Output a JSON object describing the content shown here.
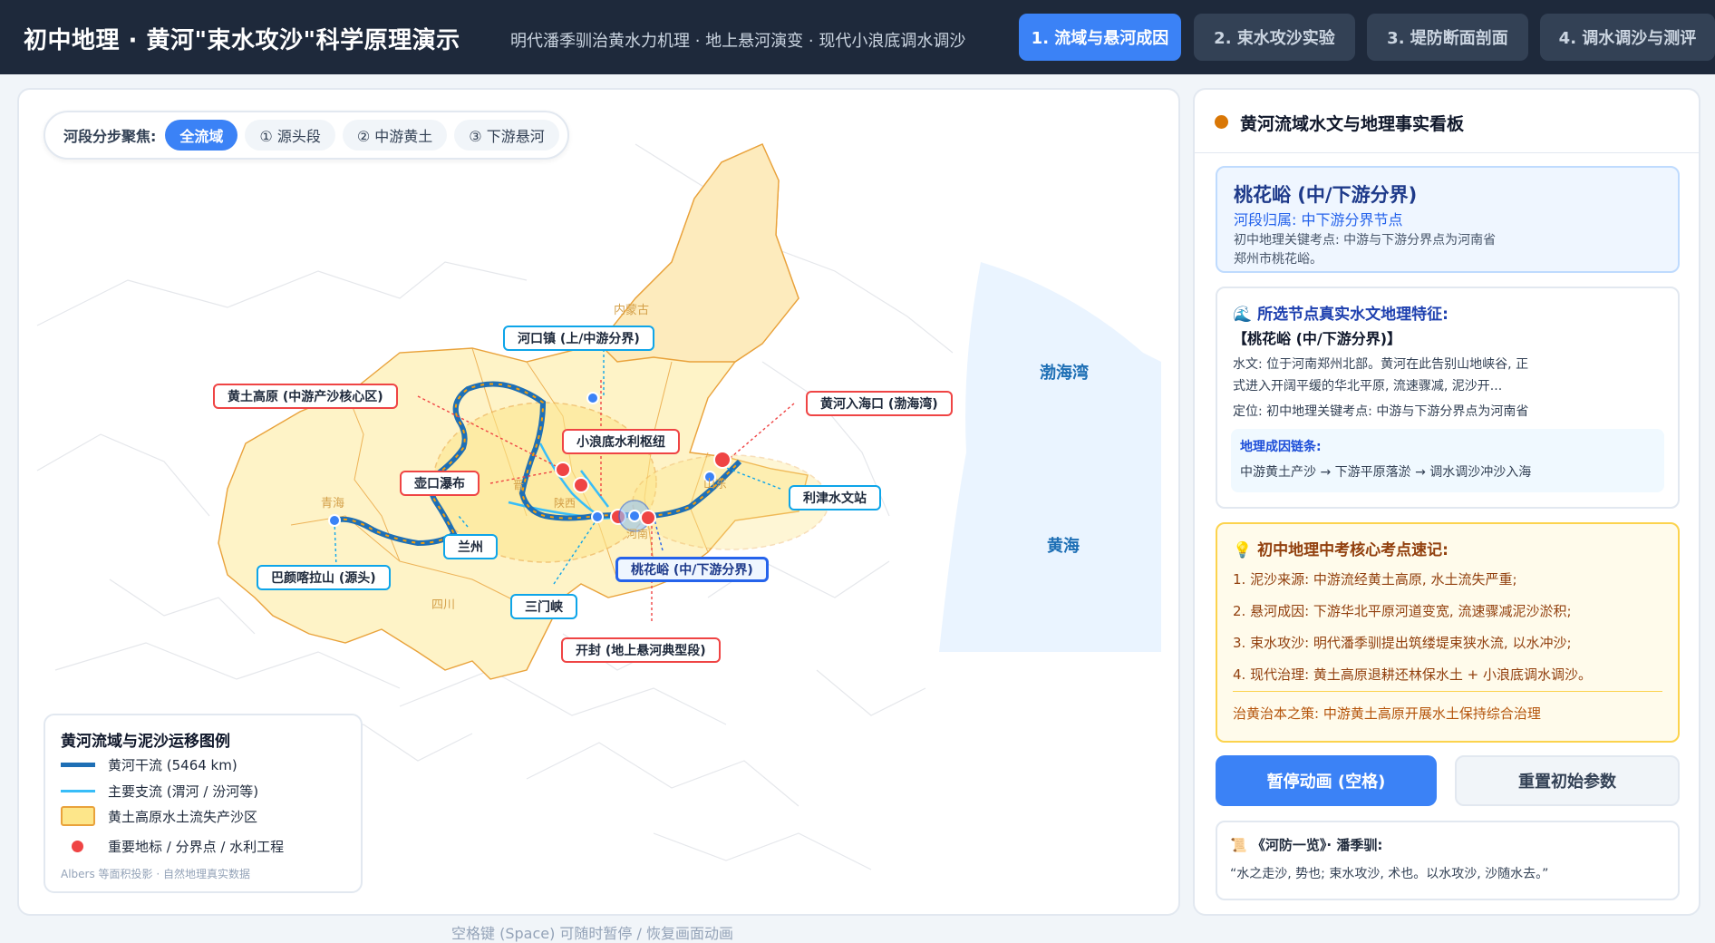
{
  "header": {
    "title": "初中地理 · 黄河\"束水攻沙\"科学原理演示",
    "subtitle": "明代潘季驯治黄水力机理 · 地上悬河演变 · 现代小浪底调水调沙",
    "tabs": [
      {
        "label": "1. 流域与悬河成因",
        "active": true
      },
      {
        "label": "2. 束水攻沙实验",
        "active": false
      },
      {
        "label": "3. 堤防断面剖面",
        "active": false
      },
      {
        "label": "4. 调水调沙与测评",
        "active": false
      }
    ]
  },
  "map": {
    "segment_label": "河段分步聚焦:",
    "segments": [
      {
        "label": "全流域",
        "active": true
      },
      {
        "label": "① 源头段",
        "active": false
      },
      {
        "label": "② 中游黄土",
        "active": false
      },
      {
        "label": "③ 下游悬河",
        "active": false
      }
    ],
    "sea_labels": [
      "渤海湾",
      "黄海"
    ],
    "region_labels": [
      "内蒙古",
      "青海",
      "四川",
      "山东",
      "陕西",
      "河南",
      "晋"
    ],
    "callouts": {
      "hekou": "河口镇 (上/中游分界)",
      "loess": "黄土高原 (中游产沙核心区)",
      "estuary": "黄河入海口 (渤海湾)",
      "xiaolangdi": "小浪底水利枢纽",
      "hukou": "壶口瀑布",
      "lijin": "利津水文站",
      "lanzhou": "兰州",
      "bayan": "巴颜喀拉山 (源头)",
      "taohuayu": "桃花峪 (中/下游分界)",
      "sanmenxia": "三门峡",
      "kaifeng": "开封 (地上悬河典型段)"
    },
    "legend": {
      "title": "黄河流域与泥沙运移图例",
      "items": [
        {
          "label": "黄河干流 (5464 km)",
          "color": "#1e6fb5"
        },
        {
          "label": "主要支流 (渭河 / 汾河等)",
          "color": "#38bdf8"
        },
        {
          "label": "黄土高原水土流失产沙区",
          "color": "#fde68a"
        },
        {
          "label": "重要地标 / 分界点 / 水利工程",
          "color": "#ef4444"
        }
      ],
      "note": "Albers 等面积投影 · 自然地理真实数据"
    }
  },
  "footer_hint": "空格键 (Space) 可随时暂停 / 恢复画面动画",
  "panel": {
    "title": "黄河流域水文与地理事实看板",
    "node": {
      "name": "桃花峪 (中/下游分界)",
      "section": "河段归属: 中下游分界节点",
      "key_point": "初中地理关键考点: 中游与下游分界点为河南省郑州市桃花峪。"
    },
    "feature": {
      "title": "🌊 所选节点真实水文地理特征:",
      "name": "【桃花峪 (中/下游分界)】",
      "hydro": "水文: 位于河南郑州北部。黄河在此告别山地峡谷, 正式进入开阔平缓的华北平原, 流速骤减, 泥沙开...",
      "position": "定位: 初中地理关键考点: 中游与下游分界点为河南省",
      "chain_title": "地理成因链条:",
      "chain": "中游黄土产沙 → 下游平原落淤 → 调水调沙冲沙入海"
    },
    "exam": {
      "title": "💡 初中地理中考核心考点速记:",
      "items": [
        "1. 泥沙来源: 中游流经黄土高原, 水土流失严重;",
        "2. 悬河成因: 下游华北平原河道变宽, 流速骤减泥沙淤积;",
        "3. 束水攻沙: 明代潘季驯提出筑缕堤束狭水流, 以水冲沙;",
        "4. 现代治理: 黄土高原退耕还林保水土 + 小浪底调水调沙。"
      ],
      "footer": "治黄治本之策: 中游黄土高原开展水土保持综合治理"
    },
    "buttons": {
      "pause": "暂停动画 (空格)",
      "reset": "重置初始参数"
    },
    "quote": {
      "title": "📜 《河防一览》· 潘季驯:",
      "text": "“水之走沙, 势也; 束水攻沙, 术也。以水攻沙, 沙随水去。”"
    }
  }
}
